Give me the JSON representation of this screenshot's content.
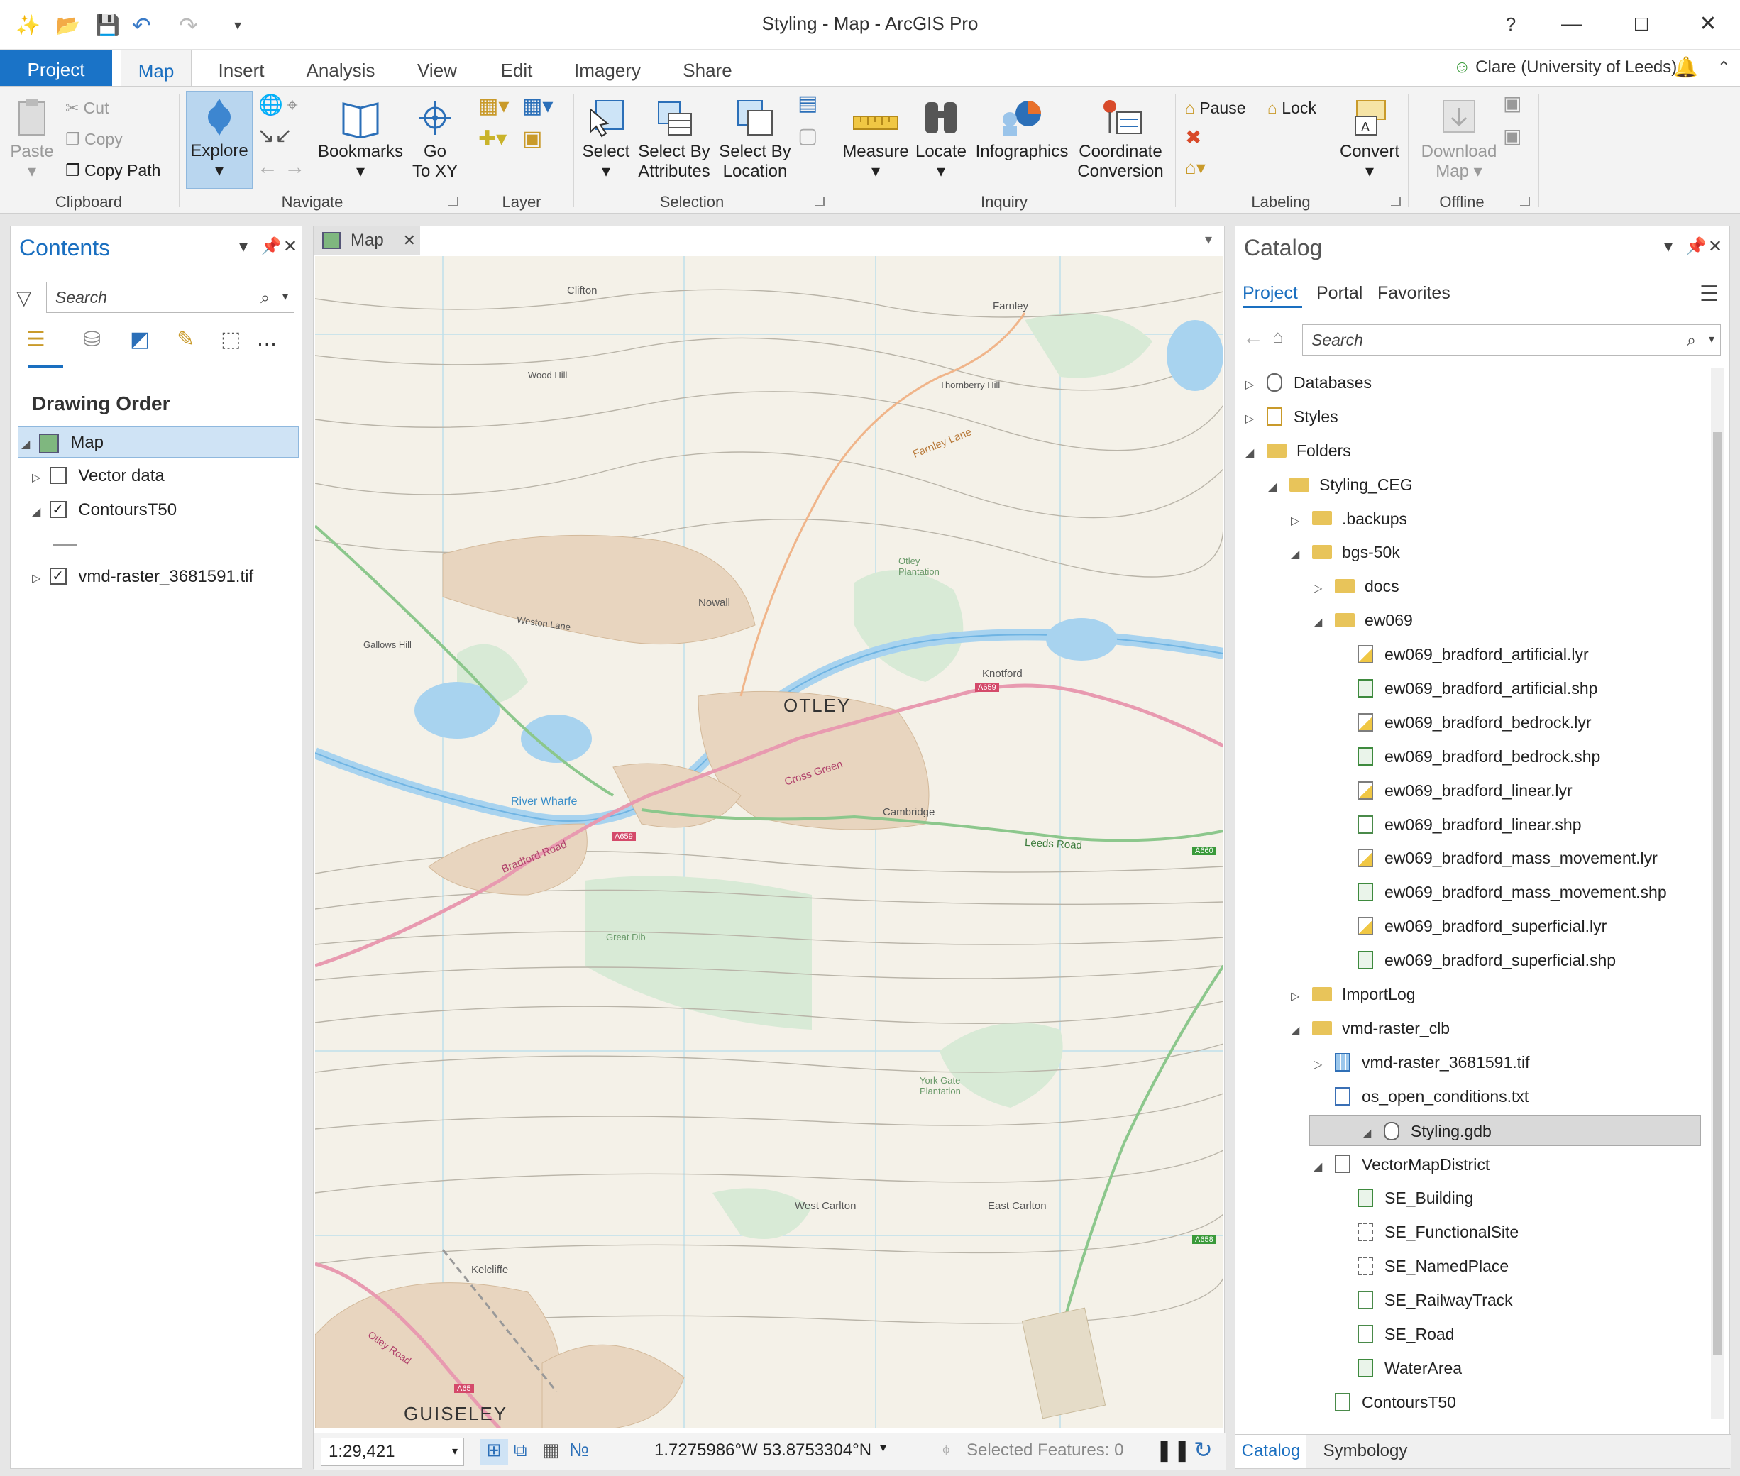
{
  "window": {
    "title": "Styling - Map - ArcGIS Pro",
    "help": "?",
    "user": "Clare (University of Leeds)"
  },
  "tabs": {
    "project": "Project",
    "map": "Map",
    "insert": "Insert",
    "analysis": "Analysis",
    "view": "View",
    "edit": "Edit",
    "imagery": "Imagery",
    "share": "Share"
  },
  "ribbon": {
    "clipboard": {
      "paste": "Paste",
      "cut": "Cut",
      "copy": "Copy",
      "copy_path": "Copy Path",
      "label": "Clipboard"
    },
    "navigate": {
      "explore": "Explore",
      "bookmarks": "Bookmarks",
      "go": "Go",
      "to_xy": "To XY",
      "label": "Navigate"
    },
    "layer": {
      "label": "Layer"
    },
    "selection": {
      "select": "Select",
      "select_by": "Select By",
      "attributes": "Attributes",
      "select_by2": "Select By",
      "location": "Location",
      "label": "Selection"
    },
    "inquiry": {
      "measure": "Measure",
      "locate": "Locate",
      "infographics": "Infographics",
      "coordinate": "Coordinate",
      "conversion": "Conversion",
      "label": "Inquiry"
    },
    "labeling": {
      "pause": "Pause",
      "lock": "Lock",
      "convert": "Convert",
      "label": "Labeling"
    },
    "offline": {
      "download": "Download",
      "map": "Map",
      "label": "Offline"
    }
  },
  "contents": {
    "title": "Contents",
    "search_placeholder": "Search",
    "drawing_order": "Drawing Order",
    "items": [
      {
        "label": "Map"
      },
      {
        "label": "Vector data",
        "checked": false
      },
      {
        "label": "ContoursT50",
        "checked": true
      },
      {
        "label": "vmd-raster_3681591.tif",
        "checked": true
      }
    ]
  },
  "mapview": {
    "tab": "Map",
    "scale": "1:29,421",
    "coordinates": "1.7275986°W 53.8753304°N",
    "selected_features": "Selected Features: 0",
    "labels": {
      "otley": "OTLEY",
      "guiseley": "GUISELEY",
      "clifton": "Clifton",
      "farnley": "Farnley",
      "nowall": "Nowall",
      "knotford": "Knotford",
      "cambridge": "Cambridge",
      "river_wharfe": "River Wharfe",
      "cross_green": "Cross Green",
      "bradford_road": "Bradford Road",
      "leeds_road": "Leeds Road",
      "farnley_lane": "Farnley Lane",
      "thornberry_hill": "Thornberry Hill",
      "otley_plantation": "Otley Plantation",
      "east_carlton": "East Carlton",
      "west_carlton": "West Carlton",
      "kelcliffe": "Kelcliffe",
      "a659": "A659",
      "a660": "A660",
      "a658": "A658",
      "a65": "A65",
      "wood_hill": "Wood Hill",
      "weston_lane": "Weston Lane",
      "gallows_hill": "Gallows Hill",
      "great_dib": "Great Dib",
      "york_gate": "York Gate Plantation",
      "otley_road": "Otley Road"
    }
  },
  "catalog": {
    "title": "Catalog",
    "tabs": [
      "Project",
      "Portal",
      "Favorites"
    ],
    "search_placeholder": "Search",
    "bottom_tabs": [
      "Catalog",
      "Symbology"
    ],
    "tree": [
      {
        "label": "Databases",
        "icon": "database",
        "level": 0,
        "expander": "collapsed"
      },
      {
        "label": "Styles",
        "icon": "style",
        "level": 0,
        "expander": "collapsed"
      },
      {
        "label": "Folders",
        "icon": "folder",
        "level": 0,
        "expander": "expanded"
      },
      {
        "label": "Styling_CEG",
        "icon": "home-folder",
        "level": 1,
        "expander": "expanded"
      },
      {
        "label": ".backups",
        "icon": "folder",
        "level": 2,
        "expander": "collapsed"
      },
      {
        "label": "bgs-50k",
        "icon": "folder",
        "level": 2,
        "expander": "expanded"
      },
      {
        "label": "docs",
        "icon": "folder",
        "level": 3,
        "expander": "collapsed"
      },
      {
        "label": "ew069",
        "icon": "folder",
        "level": 3,
        "expander": "expanded"
      },
      {
        "label": "ew069_bradford_artificial.lyr",
        "icon": "lyr",
        "level": 4
      },
      {
        "label": "ew069_bradford_artificial.shp",
        "icon": "shp",
        "level": 4
      },
      {
        "label": "ew069_bradford_bedrock.lyr",
        "icon": "lyr",
        "level": 4
      },
      {
        "label": "ew069_bradford_bedrock.shp",
        "icon": "shp",
        "level": 4
      },
      {
        "label": "ew069_bradford_linear.lyr",
        "icon": "lyr",
        "level": 4
      },
      {
        "label": "ew069_bradford_linear.shp",
        "icon": "line",
        "level": 4
      },
      {
        "label": "ew069_bradford_mass_movement.lyr",
        "icon": "lyr",
        "level": 4
      },
      {
        "label": "ew069_bradford_mass_movement.shp",
        "icon": "shp",
        "level": 4
      },
      {
        "label": "ew069_bradford_superficial.lyr",
        "icon": "lyr",
        "level": 4
      },
      {
        "label": "ew069_bradford_superficial.shp",
        "icon": "shp",
        "level": 4
      },
      {
        "label": "ImportLog",
        "icon": "folder",
        "level": 2,
        "expander": "collapsed"
      },
      {
        "label": "vmd-raster_clb",
        "icon": "folder",
        "level": 2,
        "expander": "expanded"
      },
      {
        "label": "vmd-raster_3681591.tif",
        "icon": "raster",
        "level": 3,
        "expander": "collapsed"
      },
      {
        "label": "os_open_conditions.txt",
        "icon": "txt",
        "level": 3
      },
      {
        "label": "Styling.gdb",
        "icon": "gdb",
        "level": 2,
        "expander": "expanded",
        "selected": true
      },
      {
        "label": "VectorMapDistrict",
        "icon": "dataset",
        "level": 3,
        "expander": "expanded"
      },
      {
        "label": "SE_Building",
        "icon": "shp",
        "level": 4
      },
      {
        "label": "SE_FunctionalSite",
        "icon": "pt",
        "level": 4
      },
      {
        "label": "SE_NamedPlace",
        "icon": "pt",
        "level": 4
      },
      {
        "label": "SE_RailwayTrack",
        "icon": "line",
        "level": 4
      },
      {
        "label": "SE_Road",
        "icon": "line",
        "level": 4
      },
      {
        "label": "WaterArea",
        "icon": "shp",
        "level": 4
      },
      {
        "label": "ContoursT50",
        "icon": "line",
        "level": 3
      }
    ]
  }
}
